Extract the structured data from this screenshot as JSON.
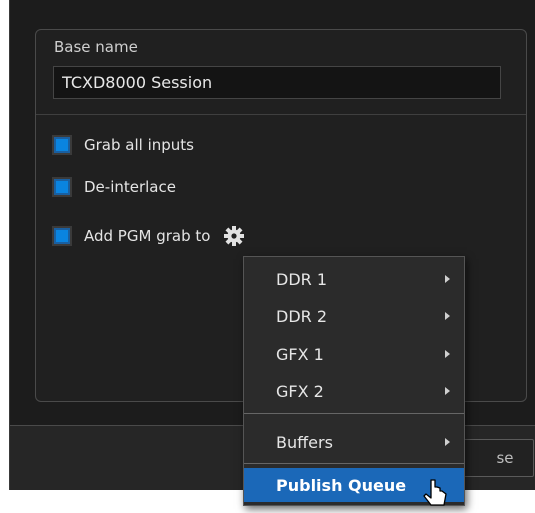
{
  "base": {
    "label": "Base name",
    "value": "TCXD8000 Session"
  },
  "checks": [
    {
      "label": "Grab all inputs",
      "checked": true
    },
    {
      "label": "De-interlace",
      "checked": true
    },
    {
      "label": "Add PGM grab to",
      "checked": true
    }
  ],
  "icons": {
    "settings": "gear-icon",
    "submenu": "chevron-right-icon",
    "cursor": "pointer-cursor-icon"
  },
  "close_button": {
    "label": "se"
  },
  "menu": {
    "items": [
      {
        "label": "DDR 1",
        "submenu": true
      },
      {
        "label": "DDR 2",
        "submenu": true
      },
      {
        "label": "GFX 1",
        "submenu": true
      },
      {
        "label": "GFX 2",
        "submenu": true
      },
      {
        "label": "Buffers",
        "submenu": true
      },
      {
        "label": "Publish Queue",
        "submenu": false,
        "selected": true
      }
    ]
  },
  "colors": {
    "accent": "#1b68b8",
    "checkbox": "#0a84e0",
    "background": "#1c1c1c"
  }
}
